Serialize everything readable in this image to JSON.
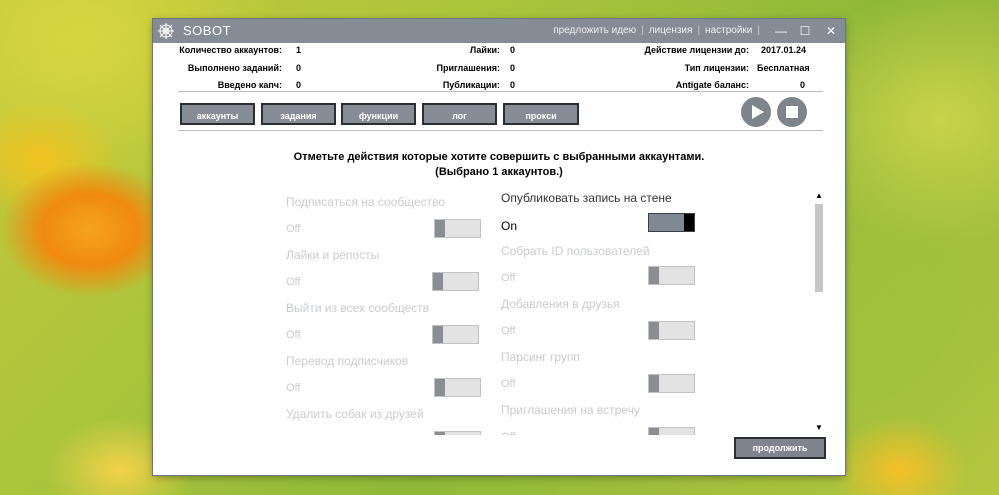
{
  "window": {
    "title": "SOBOT",
    "links": [
      "предложить идею",
      "лицензия",
      "настройки"
    ],
    "minimize_glyph": "—",
    "maximize_glyph": "☐",
    "close_glyph": "✕"
  },
  "stats": {
    "accounts_label": "Количество аккаунтов:",
    "accounts_value": "1",
    "tasks_label": "Выполнено заданий:",
    "tasks_value": "0",
    "captcha_label": "Введено капч:",
    "captcha_value": "0",
    "likes_label": "Лайки:",
    "likes_value": "0",
    "invites_label": "Приглашения:",
    "invites_value": "0",
    "posts_label": "Публикации:",
    "posts_value": "0",
    "license_until_label": "Действие лицензии до:",
    "license_until_value": "2017.01.24",
    "license_type_label": "Тип лицензии:",
    "license_type_value": "Бесплатная",
    "antigate_label": "Antigate баланс:",
    "antigate_value": "0"
  },
  "tabs": [
    "аккаунты",
    "задания",
    "функции",
    "лог",
    "прокси"
  ],
  "icons": {
    "play": "play-icon",
    "stop": "stop-icon",
    "logo": "spider-web-icon"
  },
  "instruction": {
    "line1": "Отметьте действия которые хотите совершить с выбранными аккаунтами.",
    "line2": "(Выбрано 1 аккаунтов.)"
  },
  "actions": {
    "left": [
      {
        "title": "Подписаться на сообщество",
        "state": "Off",
        "on": false
      },
      {
        "title": "Лайки и репосты",
        "state": "Off",
        "on": false
      },
      {
        "title": "Выйти из всех сообществ",
        "state": "Off",
        "on": false
      },
      {
        "title": "Перевод подписчиков",
        "state": "Off",
        "on": false
      },
      {
        "title": "Удалить собак из друзей",
        "state": "Off",
        "on": false
      }
    ],
    "right": [
      {
        "title": "Опубликовать запись на стене",
        "state": "On",
        "on": true
      },
      {
        "title": "Собрать ID пользователей",
        "state": "Off",
        "on": false
      },
      {
        "title": "Добавления в друзья",
        "state": "Off",
        "on": false
      },
      {
        "title": "Парсинг групп",
        "state": "Off",
        "on": false
      },
      {
        "title": "Приглашения на встречу",
        "state": "Off",
        "on": false
      }
    ]
  },
  "scroll": {
    "up_glyph": "▲",
    "down_glyph": "▼"
  },
  "continue_label": "продолжить"
}
